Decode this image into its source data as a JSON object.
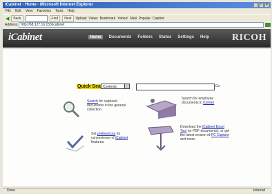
{
  "window": {
    "title": "iCabinet - Home - Microsoft Internet Explorer"
  },
  "menu": [
    "File",
    "Edit",
    "View",
    "Favorites",
    "Tools",
    "Help"
  ],
  "toolbar": {
    "back": "Back",
    "forward": "Next",
    "find": "Find",
    "items": [
      "Upload",
      "Views",
      "Bookmark",
      "Yahoo!",
      "Mail",
      "Popular",
      "Caption"
    ]
  },
  "address": {
    "label": "Address",
    "value": "http://68.127.16.153/icabinet"
  },
  "app": {
    "logo": "iCabinet",
    "brand": "RICOH",
    "nav": [
      "Home",
      "Documents",
      "Folders",
      "Status",
      "Settings",
      "Help"
    ]
  },
  "quick_search": {
    "label": "Quick Search",
    "scope": "Contents",
    "go": "Go"
  },
  "features": {
    "search": {
      "link": "Search",
      "text": " for captured documents in the general collection."
    },
    "people": {
      "text": "Search for employee documents in ",
      "link": "iCenter"
    },
    "set": {
      "text_before": "Set ",
      "link": "preferences",
      "text_after": " for convenience of ",
      "link2": "iCabinet",
      "text_end": " features."
    },
    "download": {
      "text": "Download the ",
      "link": "iCabinet Excel Tool",
      "text_mid": " (or PDF documents), or get the latest version of ",
      "link2": "PC Capture",
      "text_end": " and more."
    }
  },
  "status": {
    "left": "Done",
    "right": "Internet"
  }
}
